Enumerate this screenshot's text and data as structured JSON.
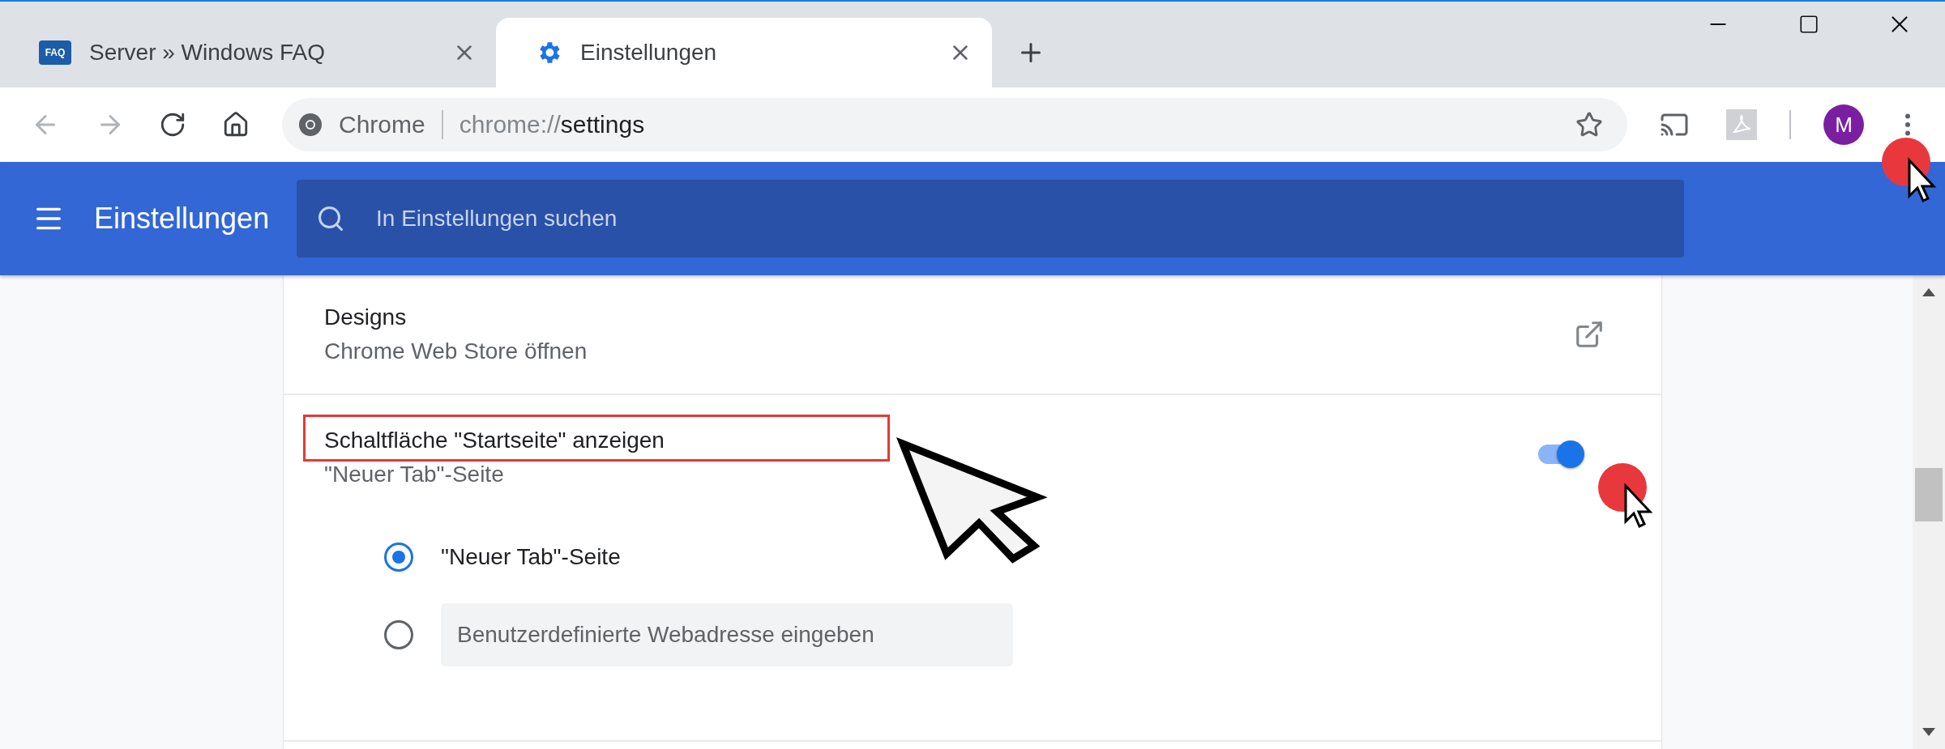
{
  "tabs": [
    {
      "favicon": "FAQ",
      "title": "Server » Windows FAQ",
      "selected": false
    },
    {
      "title": "Einstellungen",
      "selected": true
    }
  ],
  "toolbar": {
    "site_label": "Chrome",
    "url_scheme": "chrome://",
    "url_path": "settings",
    "avatar": "M"
  },
  "header": {
    "title": "Einstellungen",
    "search": {
      "placeholder": "In Einstellungen suchen"
    }
  },
  "settings": [
    {
      "kind": "link",
      "title": "Designs",
      "subtitle": "Chrome Web Store öffnen"
    },
    {
      "kind": "toggle",
      "title": "Schaltfläche \"Startseite\" anzeigen",
      "subtitle": "\"Neuer Tab\"-Seite",
      "on": true,
      "highlighted": true,
      "options": [
        {
          "kind": "text",
          "label": "\"Neuer Tab\"-Seite",
          "selected": true
        },
        {
          "kind": "input",
          "placeholder": "Benutzerdefinierte Webadresse eingeben",
          "selected": false
        }
      ]
    }
  ]
}
